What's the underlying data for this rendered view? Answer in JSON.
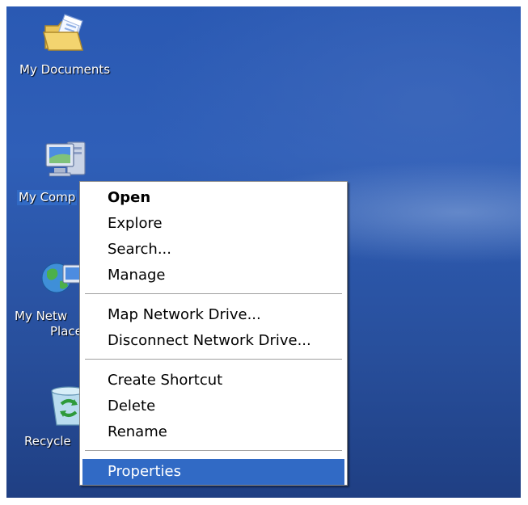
{
  "desktop": {
    "icons": [
      {
        "label": "My Documents",
        "icon": "folder-icon"
      },
      {
        "label": "My Comp",
        "icon": "computer-icon"
      },
      {
        "label": "My Netw",
        "label_line2": "Place",
        "icon": "network-places-icon"
      },
      {
        "label": "Recycle",
        "icon": "recycle-bin-icon"
      }
    ]
  },
  "context_menu": {
    "items": [
      {
        "label": "Open"
      },
      {
        "label": "Explore"
      },
      {
        "label": "Search..."
      },
      {
        "label": "Manage"
      },
      {
        "label": "Map Network Drive..."
      },
      {
        "label": "Disconnect Network Drive..."
      },
      {
        "label": "Create Shortcut"
      },
      {
        "label": "Delete"
      },
      {
        "label": "Rename"
      },
      {
        "label": "Properties"
      }
    ],
    "highlighted": "Properties"
  },
  "colors": {
    "desktop_blue": "#2a59b3",
    "selection": "#316ac5",
    "menu_bg": "#ffffff"
  }
}
